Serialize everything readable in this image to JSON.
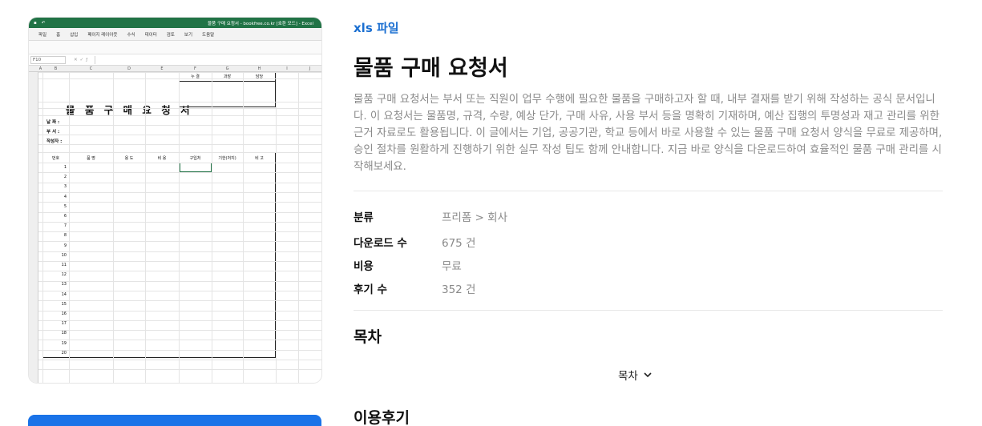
{
  "preview": {
    "excel_title": "물품 구매 요청서 - bookfree.co.kr [호환 모드] - Excel",
    "menu": [
      "파일",
      "홈",
      "삽입",
      "페이지 레이아웃",
      "수식",
      "데이터",
      "검토",
      "보기",
      "도움말"
    ],
    "name_box": "F10",
    "columns": [
      "A",
      "B",
      "C",
      "D",
      "E",
      "F",
      "G",
      "H",
      "I",
      "J"
    ],
    "sheet": {
      "title": "물 품 구 매 요 청 서",
      "approval_headers": [
        "누 결",
        "과장",
        "담당"
      ],
      "fields": [
        "날 짜 :",
        "부 서 :",
        "작성자 :"
      ],
      "table_headers": [
        "번호",
        "품 명",
        "용 도",
        "비 용",
        "구입처",
        "기한(처지)",
        "비 고"
      ],
      "row_numbers": [
        "1",
        "2",
        "3",
        "4",
        "5",
        "6",
        "7",
        "8",
        "9",
        "10",
        "11",
        "12",
        "13",
        "14",
        "15",
        "16",
        "17",
        "18",
        "19",
        "20"
      ]
    }
  },
  "file_type": "xls 파일",
  "title": "물품 구매 요청서",
  "description": "물품 구매 요청서는 부서 또는 직원이 업무 수행에 필요한 물품을 구매하고자 할 때, 내부 결재를 받기 위해 작성하는 공식 문서입니다. 이 요청서는 물품명, 규격, 수량, 예상 단가, 구매 사유, 사용 부서 등을 명확히 기재하며, 예산 집행의 투명성과 재고 관리를 위한 근거 자료로도 활용됩니다. 이 글에서는 기업, 공공기관, 학교 등에서 바로 사용할 수 있는 물품 구매 요청서 양식을 무료로 제공하며, 승인 절차를 원활하게 진행하기 위한 실무 작성 팁도 함께 안내합니다. 지금 바로 양식을 다운로드하여 효율적인 물품 구매 관리를 시작해보세요.",
  "meta": [
    {
      "key": "분류",
      "value": "프리폼 > 회사"
    },
    {
      "key": "다운로드 수",
      "value": "675 건"
    },
    {
      "key": "비용",
      "value": "무료"
    },
    {
      "key": "후기 수",
      "value": "352 건"
    }
  ],
  "toc": {
    "heading": "목차",
    "toggle_label": "목차",
    "toggle_icon": "chevron-down-icon"
  },
  "reviews": {
    "heading": "이용후기"
  },
  "colors": {
    "accent": "#1b6fd1",
    "excel_green": "#217346",
    "button": "#1a73e8"
  }
}
